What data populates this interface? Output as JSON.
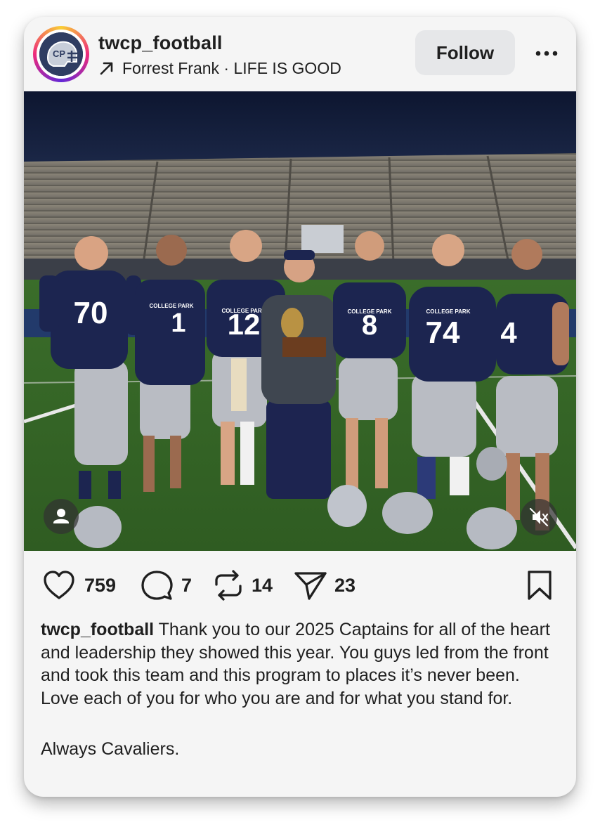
{
  "post": {
    "username": "twcp_football",
    "audio": "Forrest Frank · LIFE IS GOOD",
    "follow_label": "Follow",
    "avatar_logo": "CP"
  },
  "photo": {
    "jersey_numbers": [
      "70",
      "1",
      "12",
      "8",
      "74",
      "4"
    ],
    "jersey_team_text": "COLLEGE PARK"
  },
  "actions": {
    "likes": "759",
    "comments": "7",
    "reposts": "14",
    "shares": "23"
  },
  "caption": {
    "username": "twcp_football",
    "text": " Thank you to our 2025 Captains for all of the heart and leadership they showed this year. You guys led from the front and took this team and this program to places it’s never been. Love each of you for who you are and for what you stand for.",
    "signoff": "Always Cavaliers."
  },
  "icons": {
    "audio": "arrow-up-right-icon",
    "more": "more-horizontal-icon",
    "like": "heart-icon",
    "comment": "comment-icon",
    "repost": "repost-icon",
    "share": "send-icon",
    "save": "bookmark-icon",
    "user_tag": "user-icon",
    "mute": "speaker-muted-icon"
  },
  "colors": {
    "card_bg": "#f5f5f5",
    "follow_bg": "#e6e7e9",
    "jersey_navy": "#1c2550",
    "field_green": "#3f7a2c",
    "text": "#1f1f1f"
  }
}
